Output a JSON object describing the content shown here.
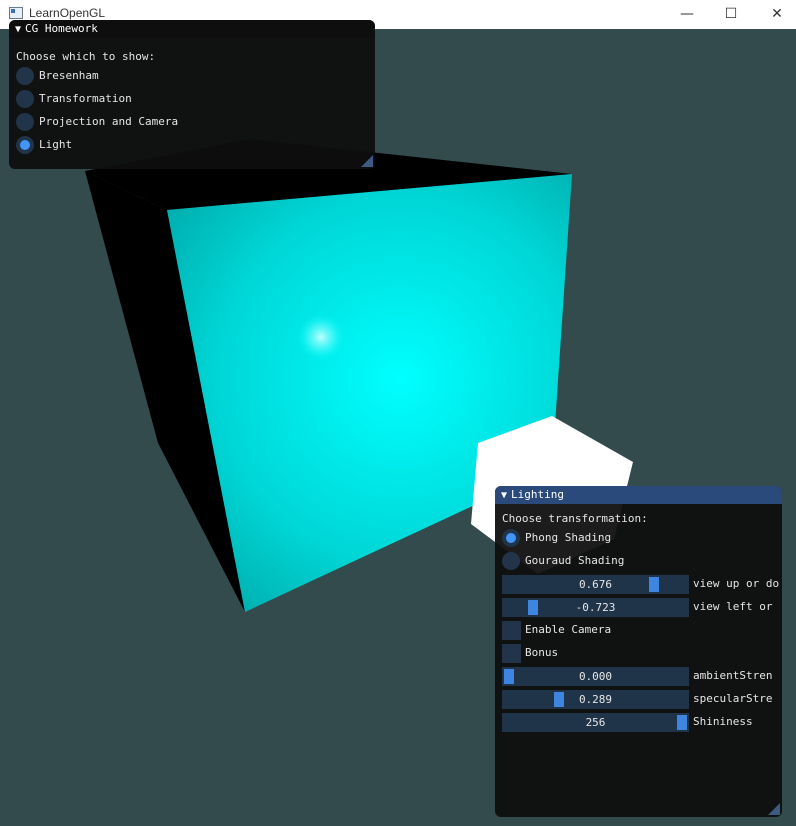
{
  "window": {
    "title": "LearnOpenGL",
    "minimize_glyph": "—",
    "maximize_glyph": "☐",
    "close_glyph": "✕"
  },
  "colors": {
    "clear_color": "#334b4d",
    "cube_color": "#00ffff",
    "lamp_color": "#ffffff",
    "accent": "#4296fa",
    "frame_bg": "#203449"
  },
  "homework_panel": {
    "title": "CG Homework",
    "collapse_glyph": "▼",
    "prompt": "Choose which to show:",
    "options": [
      {
        "label": "Bresenham",
        "selected": false
      },
      {
        "label": "Transformation",
        "selected": false
      },
      {
        "label": "Projection and Camera",
        "selected": false
      },
      {
        "label": "Light",
        "selected": true
      }
    ]
  },
  "lighting_panel": {
    "title": "Lighting",
    "collapse_glyph": "▼",
    "prompt": "Choose transformation:",
    "shading_options": [
      {
        "label": "Phong Shading",
        "selected": true
      },
      {
        "label": "Gouraud Shading",
        "selected": false
      }
    ],
    "view_up_slider": {
      "value": "0.676",
      "fraction": 0.838,
      "label": "view up or do"
    },
    "view_left_slider": {
      "value": "-0.723",
      "fraction": 0.1385,
      "label": "view left or"
    },
    "enable_camera": {
      "label": "Enable Camera",
      "checked": false
    },
    "bonus": {
      "label": "Bonus",
      "checked": false
    },
    "ambient_slider": {
      "value": "0.000",
      "fraction": 0.0,
      "label": "ambientStren"
    },
    "specular_slider": {
      "value": "0.289",
      "fraction": 0.289,
      "label": "specularStre"
    },
    "shininess_slider": {
      "value": "256",
      "fraction": 1.0,
      "label": "Shininess"
    }
  }
}
